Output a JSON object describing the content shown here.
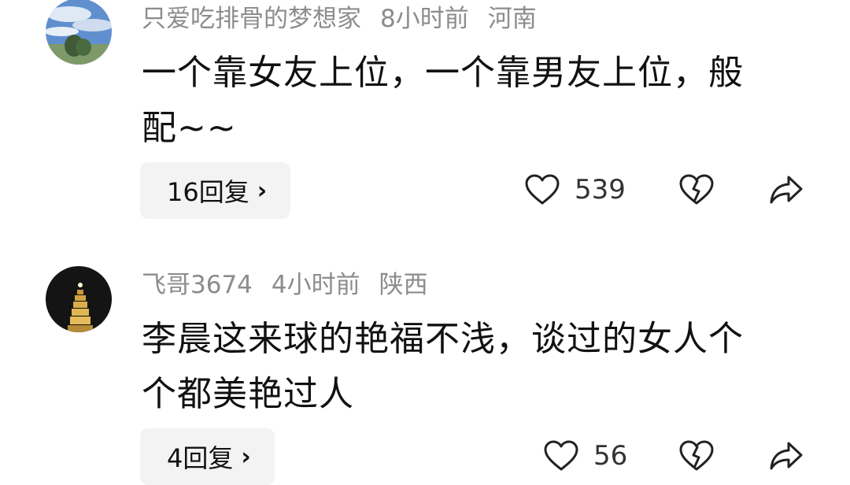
{
  "comments": [
    {
      "username": "只爱吃排骨的梦想家",
      "time": "8小时前",
      "location": "河南",
      "text_line1": "一个靠女友上位，一个靠男友上位，般",
      "text_line2": "配~~",
      "reply_label": "16回复",
      "like_count": "539",
      "avatar_icon": "sky-landscape-avatar"
    },
    {
      "username": "飞哥3674",
      "time": "4小时前",
      "location": "陕西",
      "text_line1": "李晨这来球的艳福不浅，谈过的女人个",
      "text_line2": "个都美艳过人",
      "reply_label": "4回复",
      "like_count": "56",
      "avatar_icon": "pagoda-night-avatar"
    }
  ],
  "icons": {
    "chevron": "›",
    "like": "heart-icon",
    "dislike": "broken-heart-icon",
    "share": "share-icon"
  }
}
